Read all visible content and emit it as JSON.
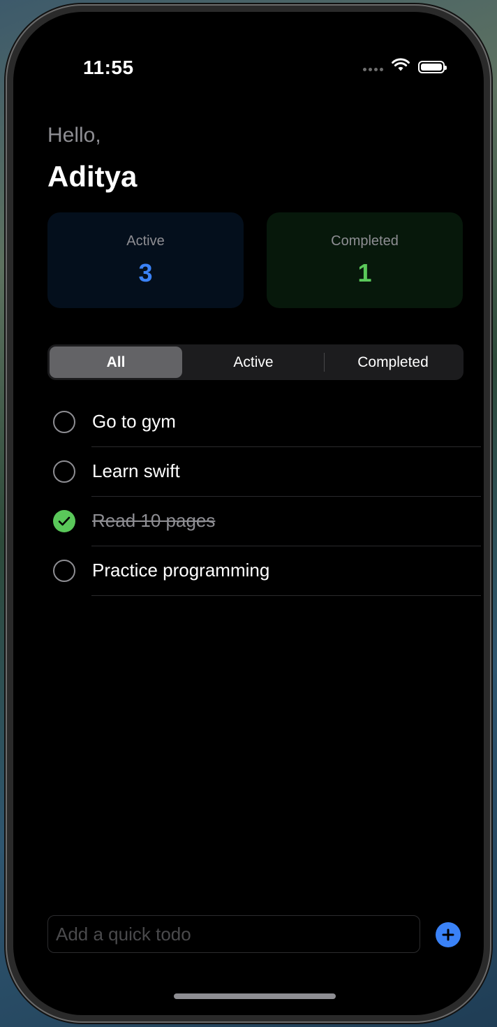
{
  "status_bar": {
    "time": "11:55",
    "icons": [
      "signal-dots-icon",
      "wifi-icon",
      "battery-icon"
    ]
  },
  "header": {
    "greeting": "Hello,",
    "name": "Aditya"
  },
  "stats": {
    "active": {
      "label": "Active",
      "value": "3",
      "color": "#3a82f7"
    },
    "completed": {
      "label": "Completed",
      "value": "1",
      "color": "#5ac85a"
    }
  },
  "filter": {
    "options": [
      "All",
      "Active",
      "Completed"
    ],
    "selected": "All"
  },
  "todos": [
    {
      "title": "Go to gym",
      "completed": false
    },
    {
      "title": "Learn swift",
      "completed": false
    },
    {
      "title": "Read 10 pages",
      "completed": true
    },
    {
      "title": "Practice programming",
      "completed": false
    }
  ],
  "quick_add": {
    "placeholder": "Add a quick todo",
    "value": "",
    "button_icon": "plus-circle-icon"
  },
  "colors": {
    "accent": "#3a82f7",
    "success": "#5ac85a",
    "background": "#000000"
  }
}
